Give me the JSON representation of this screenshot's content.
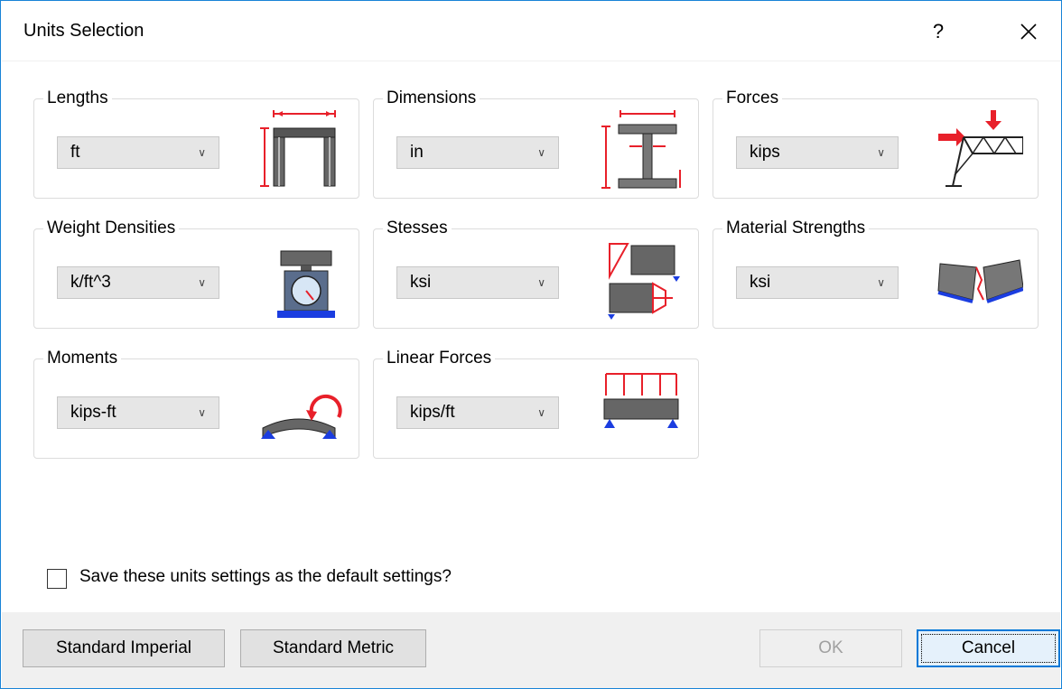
{
  "window": {
    "title": "Units Selection",
    "help_glyph": "?",
    "close_icon": "close-icon"
  },
  "groups": [
    {
      "label": "Lengths",
      "value": "ft",
      "icon": "lengths-frame-icon"
    },
    {
      "label": "Dimensions",
      "value": "in",
      "icon": "dimensions-ibeam-icon"
    },
    {
      "label": "Forces",
      "value": "kips",
      "icon": "forces-truss-icon"
    },
    {
      "label": "Weight Densities",
      "value": "k/ft^3",
      "icon": "weight-scale-icon"
    },
    {
      "label": "Stesses",
      "value": "ksi",
      "icon": "stresses-block-icon"
    },
    {
      "label": "Material Strengths",
      "value": "ksi",
      "icon": "material-fracture-icon"
    },
    {
      "label": "Moments",
      "value": "kips-ft",
      "icon": "moment-beam-icon"
    },
    {
      "label": "Linear Forces",
      "value": "kips/ft",
      "icon": "linear-load-beam-icon"
    }
  ],
  "save_default": {
    "label": "Save these units settings as the default settings?",
    "checked": false
  },
  "buttons": {
    "imperial": "Standard Imperial",
    "metric": "Standard Metric",
    "ok": "OK",
    "cancel": "Cancel"
  },
  "colors": {
    "accent_red": "#e8202a",
    "support_blue": "#1b3de0",
    "window_border": "#1883d7"
  }
}
